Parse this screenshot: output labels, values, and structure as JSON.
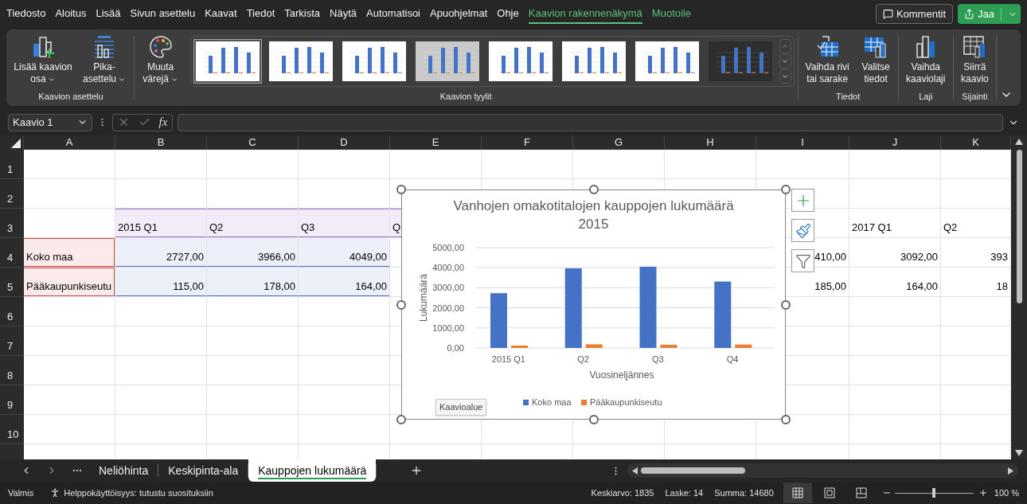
{
  "menu_tabs": [
    {
      "label": "Tiedosto",
      "selected": false,
      "contextual": false
    },
    {
      "label": "Aloitus",
      "selected": false,
      "contextual": false
    },
    {
      "label": "Lisää",
      "selected": false,
      "contextual": false
    },
    {
      "label": "Sivun asettelu",
      "selected": false,
      "contextual": false
    },
    {
      "label": "Kaavat",
      "selected": false,
      "contextual": false
    },
    {
      "label": "Tiedot",
      "selected": false,
      "contextual": false
    },
    {
      "label": "Tarkista",
      "selected": false,
      "contextual": false
    },
    {
      "label": "Näytä",
      "selected": false,
      "contextual": false
    },
    {
      "label": "Automatisoi",
      "selected": false,
      "contextual": false
    },
    {
      "label": "Apuohjelmat",
      "selected": false,
      "contextual": false
    },
    {
      "label": "Ohje",
      "selected": false,
      "contextual": false
    },
    {
      "label": "Kaavion rakennenäkymä",
      "selected": true,
      "contextual": true
    },
    {
      "label": "Muotoile",
      "selected": false,
      "contextual": true
    }
  ],
  "comments_button": "Kommentit",
  "share_button": "Jaa",
  "ribbon": {
    "groups": [
      {
        "label": "Kaavion asettelu",
        "buttons": [
          {
            "kind": "add-element",
            "label": "Lisää kaavion osa",
            "dropdown": true
          },
          {
            "kind": "quick-layout",
            "label": "Pika-asettelu",
            "dropdown": true
          }
        ]
      },
      {
        "label": "Kaavion tyylit",
        "buttons": [
          {
            "kind": "colors",
            "label": "Muuta värejä",
            "dropdown": true
          }
        ],
        "gallery": [
          {
            "kind": "light",
            "selected": true
          },
          {
            "kind": "light",
            "selected": false
          },
          {
            "kind": "light",
            "selected": false
          },
          {
            "kind": "gray",
            "selected": false
          },
          {
            "kind": "light",
            "selected": false
          },
          {
            "kind": "light",
            "selected": false
          },
          {
            "kind": "light",
            "selected": false
          },
          {
            "kind": "dark",
            "selected": false
          }
        ]
      },
      {
        "label": "Tiedot",
        "buttons": [
          {
            "kind": "switch",
            "label": "Vaihda rivi tai sarake",
            "dropdown": false
          },
          {
            "kind": "select-data",
            "label": "Valitse tiedot",
            "dropdown": false
          }
        ]
      },
      {
        "label": "Laji",
        "buttons": [
          {
            "kind": "change-type",
            "label": "Vaihda kaaviolaji",
            "dropdown": false
          }
        ]
      },
      {
        "label": "Sijainti",
        "buttons": [
          {
            "kind": "move",
            "label": "Siirrä kaavio",
            "dropdown": false
          }
        ]
      }
    ]
  },
  "formula_bar": {
    "name_box": "Kaavio 1",
    "function_button": "fx"
  },
  "columns": [
    "A",
    "B",
    "C",
    "D",
    "E",
    "F",
    "G",
    "H",
    "I",
    "J",
    "K"
  ],
  "rows": [
    {
      "number": "1"
    },
    {
      "number": "2"
    },
    {
      "number": "3",
      "cells": [
        {},
        {
          "text": "2015 Q1",
          "kind": "category"
        },
        {
          "text": "Q2",
          "kind": "category"
        },
        {
          "text": "Q3",
          "kind": "category"
        },
        {
          "text": "Q",
          "kind": "category"
        },
        {},
        {},
        {},
        {},
        {
          "text": "2017 Q1",
          "kind": "text"
        },
        {
          "text": "Q2",
          "kind": "text"
        }
      ]
    },
    {
      "number": "4",
      "cells": [
        {
          "text": "Koko maa",
          "kind": "series"
        },
        {
          "text": "2727,00",
          "kind": "value"
        },
        {
          "text": "3966,00",
          "kind": "value"
        },
        {
          "text": "4049,00",
          "kind": "value"
        },
        {},
        {},
        {},
        {},
        {
          "text": "410,00",
          "kind": "number"
        },
        {
          "text": "3092,00",
          "kind": "number"
        },
        {
          "text": "393",
          "kind": "number"
        }
      ]
    },
    {
      "number": "5",
      "cells": [
        {
          "text": "Pääkaupunkiseutu",
          "kind": "series"
        },
        {
          "text": "115,00",
          "kind": "value"
        },
        {
          "text": "178,00",
          "kind": "value"
        },
        {
          "text": "164,00",
          "kind": "value"
        },
        {},
        {},
        {},
        {},
        {
          "text": "185,00",
          "kind": "number"
        },
        {
          "text": "164,00",
          "kind": "number"
        },
        {
          "text": "18",
          "kind": "number"
        }
      ]
    },
    {
      "number": "6"
    },
    {
      "number": "7"
    },
    {
      "number": "8"
    },
    {
      "number": "9"
    },
    {
      "number": "10"
    }
  ],
  "chart": {
    "tooltip": "Kaavioalue",
    "chart_data": {
      "type": "bar",
      "title": "Vanhojen omakotitalojen kauppojen lukumäärä 2015",
      "xlabel": "Vuosineljännes",
      "ylabel": "Lukumäärä",
      "categories": [
        "2015 Q1",
        "Q2",
        "Q3",
        "Q4"
      ],
      "series": [
        {
          "name": "Koko maa",
          "color": "#4472c4",
          "values": [
            2730,
            3970,
            4050,
            3310
          ]
        },
        {
          "name": "Pääkaupunkiseutu",
          "color": "#ed7d31",
          "values": [
            120,
            180,
            160,
            170
          ]
        }
      ],
      "grid": true,
      "legend": "bottom",
      "ylim": [
        0,
        5000
      ],
      "yticks": [
        {
          "value": 0,
          "label": "0,00"
        },
        {
          "value": 1000,
          "label": "1000,00"
        },
        {
          "value": 2000,
          "label": "2000,00"
        },
        {
          "value": 3000,
          "label": "3000,00"
        },
        {
          "value": 4000,
          "label": "4000,00"
        },
        {
          "value": 5000,
          "label": "5000,00"
        }
      ]
    }
  },
  "sheet_tabs": [
    {
      "label": "Neliöhinta",
      "selected": false
    },
    {
      "label": "Keskipinta-ala",
      "selected": false
    },
    {
      "label": "Kauppojen lukumäärä",
      "selected": true
    }
  ],
  "status_bar": {
    "mode": "Valmis",
    "accessibility": "Helppokäyttöisyys: tutustu suosituksiin",
    "average": "Keskiarvo: 1835",
    "count": "Laske: 14",
    "sum": "Summa: 14680",
    "views": [
      {
        "kind": "normal",
        "selected": true
      },
      {
        "kind": "page-layout",
        "selected": false
      },
      {
        "kind": "page-break",
        "selected": false
      }
    ],
    "zoom": {
      "level": 0.5,
      "reading": "100 %"
    }
  }
}
